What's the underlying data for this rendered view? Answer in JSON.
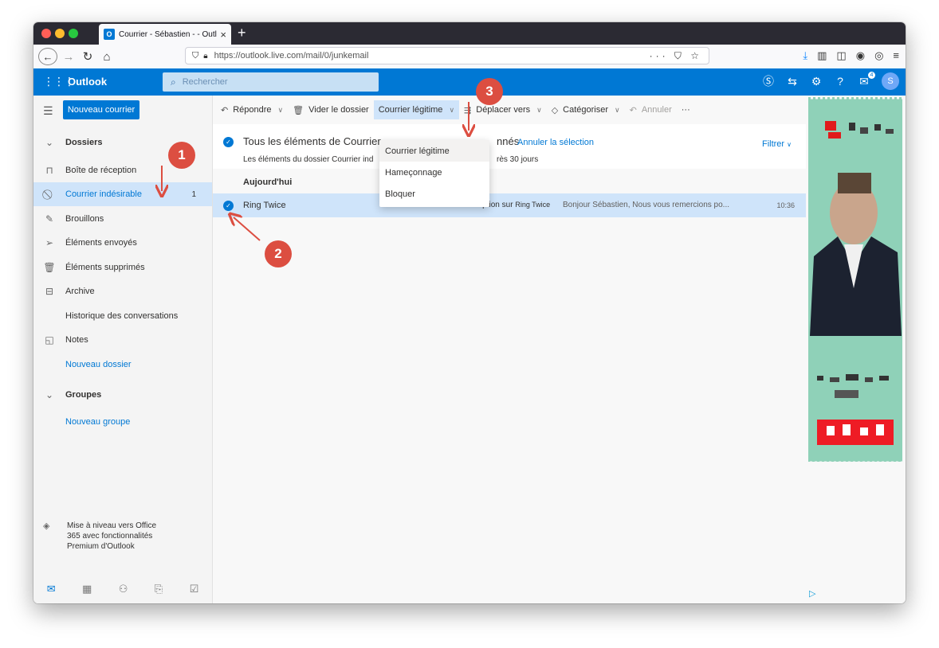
{
  "browser": {
    "tab_title": "Courrier - Sébastien - - Outlook",
    "tab_favicon": "O",
    "url": "https://outlook.live.com/mail/0/junkemail",
    "new_tab": "+"
  },
  "outlook_header": {
    "brand": "Outlook",
    "search_placeholder": "Rechercher",
    "avatar_initial": "S",
    "notification_count": "4"
  },
  "left_nav": {
    "new_mail": "Nouveau courrier",
    "folders_header": "Dossiers",
    "items": [
      {
        "label": "Boîte de réception",
        "icon": "inbox-icon"
      },
      {
        "label": "Courrier indésirable",
        "icon": "blocked-icon",
        "count": "1"
      },
      {
        "label": "Brouillons",
        "icon": "pencil-icon"
      },
      {
        "label": "Éléments envoyés",
        "icon": "send-icon"
      },
      {
        "label": "Éléments supprimés",
        "icon": "trash-icon"
      },
      {
        "label": "Archive",
        "icon": "archive-icon"
      },
      {
        "label": "Historique des conversations",
        "icon": ""
      },
      {
        "label": "Notes",
        "icon": "note-icon"
      },
      {
        "label": "Nouveau dossier",
        "icon": ""
      }
    ],
    "groups_header": "Groupes",
    "new_group": "Nouveau groupe",
    "upgrade_text": "Mise à niveau vers Office 365 avec fonctionnalités Premium d'Outlook"
  },
  "command_bar": {
    "reply": "Répondre",
    "empty_folder": "Vider le dossier",
    "not_junk": "Courrier légitime",
    "move_to": "Déplacer vers",
    "categorize": "Catégoriser",
    "undo": "Annuler",
    "more": "···"
  },
  "dropdown": {
    "items": [
      "Courrier légitime",
      "Hameçonnage",
      "Bloquer"
    ]
  },
  "message_list": {
    "banner_title": "Tous les éléments de Courrier indésirable sont sélectionnés",
    "banner_title_visible_left": "Tous les éléments de Courrier",
    "banner_title_visible_right": "nnés",
    "banner_link": "Annuler la sélection",
    "banner_sub_left": "Les éléments du dossier Courrier ind",
    "banner_sub_right": "rès 30 jours",
    "filter": "Filtrer",
    "date_group": "Aujourd'hui",
    "messages": [
      {
        "sender": "Ring Twice",
        "subject": "Validez votre inscription sur",
        "subject_brand": "Ring Twice",
        "preview": "Bonjour Sébastien, Nous vous remercions po...",
        "time": "10:36",
        "selected": true
      }
    ]
  },
  "annotations": [
    "1",
    "2",
    "3"
  ],
  "colors": {
    "outlook_blue": "#0078d4",
    "selected_bg": "#cfe4fa",
    "annotation_red": "#dc4e41"
  }
}
